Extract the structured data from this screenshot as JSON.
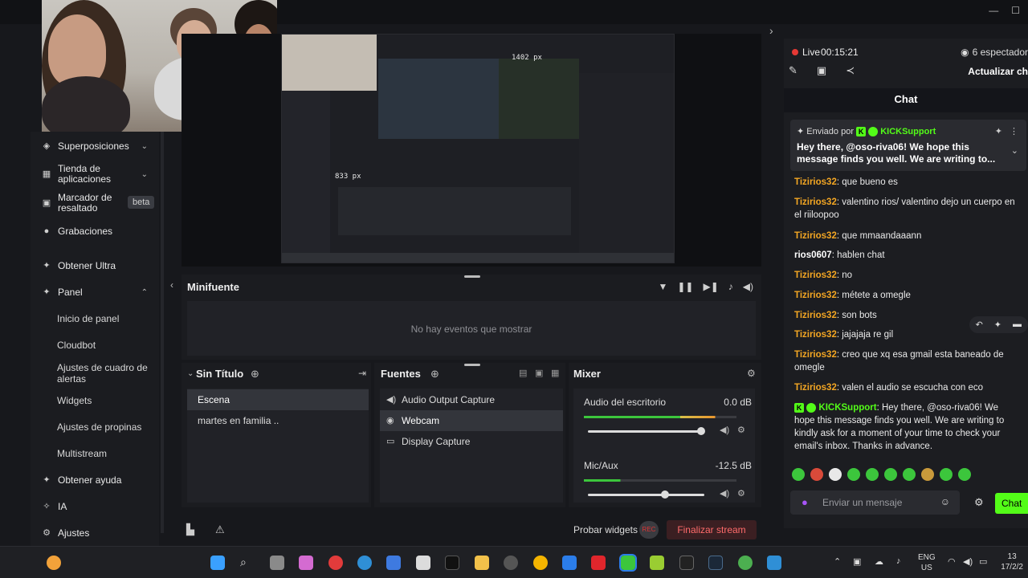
{
  "preview": {
    "width_label": "1402 px",
    "height_label": "833 px"
  },
  "sidebar": {
    "items": [
      {
        "label": "Superposiciones",
        "icon": "layers-icon"
      },
      {
        "label": "Tienda de aplicaciones",
        "icon": "store-icon"
      },
      {
        "label": "Marcador de resaltado",
        "icon": "highlight-icon"
      },
      {
        "label": "Grabaciones",
        "icon": "recordings-icon"
      },
      {
        "label": "Obtener Ultra",
        "icon": "ultra-icon"
      },
      {
        "label": "Panel",
        "icon": "panel-icon"
      },
      {
        "label": "Obtener ayuda",
        "icon": "help-icon"
      },
      {
        "label": "IA",
        "icon": "ai-icon"
      },
      {
        "label": "Ajustes",
        "icon": "settings-icon"
      }
    ],
    "beta_badge": "beta",
    "panel_subitems": [
      "Inicio de panel",
      "Cloudbot",
      "Ajustes de cuadro de alertas",
      "Widgets",
      "Ajustes de propinas",
      "Multistream"
    ]
  },
  "minifuente": {
    "title": "Minifuente",
    "empty_message": "No hay eventos que mostrar"
  },
  "scenes": {
    "title": "Sin Título",
    "items": [
      "Escena",
      "martes en familia .."
    ]
  },
  "sources": {
    "title": "Fuentes",
    "items": [
      {
        "label": "Audio Output Capture",
        "icon": "speaker-icon"
      },
      {
        "label": "Webcam",
        "icon": "webcam-icon"
      },
      {
        "label": "Display Capture",
        "icon": "monitor-icon"
      }
    ]
  },
  "mixer": {
    "title": "Mixer",
    "channels": [
      {
        "name": "Audio del escritorio",
        "db": "0.0 dB",
        "level": 0.86,
        "volume": 0.97
      },
      {
        "name": "Mic/Aux",
        "db": "-12.5 dB",
        "level": 0.24,
        "volume": 0.66
      }
    ]
  },
  "bottombar": {
    "test_widgets": "Probar widgets",
    "rec_label": "REC",
    "end_stream": "Finalizar stream"
  },
  "chat": {
    "live_label": "Live",
    "live_time": "00:15:21",
    "viewers": "6 espectador",
    "refresh": "Actualizar ch",
    "header": "Chat",
    "pinned": {
      "sent_by": "Enviado por",
      "user": "KICKSupport",
      "text": "Hey there, @oso-riva06! We hope this message finds you well. We are writing to..."
    },
    "messages": [
      {
        "user": "Tizirios32",
        "text": "que bueno es"
      },
      {
        "user": "Tizirios32",
        "text": "valentino rios/ valentino dejo un cuerpo en el riiloopoo"
      },
      {
        "user": "Tizirios32",
        "text": "que mmaandaaann"
      },
      {
        "user": "rios0607",
        "text": "hablen chat"
      },
      {
        "user": "Tizirios32",
        "text": "no"
      },
      {
        "user": "Tizirios32",
        "text": "métete a omegle"
      },
      {
        "user": "Tizirios32",
        "text": "son bots"
      },
      {
        "user": "Tizirios32",
        "text": "jajajaja re gil"
      },
      {
        "user": "Tizirios32",
        "text": "creo que xq esa gmail esta baneado de omegle"
      },
      {
        "user": "Tizirios32",
        "text": "valen el audio se escucha con eco"
      },
      {
        "user": "KICKSupport",
        "text": "Hey there, @oso-riva06! We hope this message finds you well. We are writing to kindly ask for a moment of your time to check your email's inbox. Thanks in advance."
      }
    ],
    "input_placeholder": "Enviar un mensaje",
    "send_label": "Chat"
  },
  "taskbar": {
    "lang": "ENG",
    "region": "US",
    "time": "13",
    "date": "17/2/2"
  }
}
